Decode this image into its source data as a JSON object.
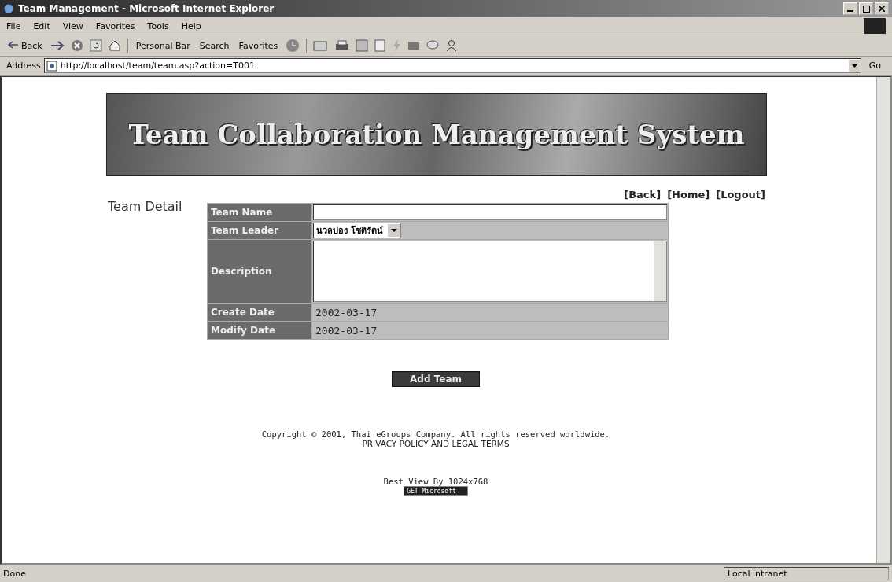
{
  "window": {
    "title": "Team Management - Microsoft Internet Explorer"
  },
  "menu": [
    "File",
    "Edit",
    "View",
    "Favorites",
    "Tools",
    "Help"
  ],
  "toolbar": {
    "back": "Back",
    "personal_bar": "Personal Bar",
    "search": "Search",
    "favorites": "Favorites"
  },
  "address": {
    "label": "Address",
    "url": "http://localhost/team/team.asp?action=T001",
    "go": "Go"
  },
  "page": {
    "banner": "Team Collaboration Management System",
    "heading": "Team Detail",
    "links": [
      "[Back]",
      "[Home]",
      "[Logout]"
    ],
    "form": [
      {
        "kind": "text",
        "label": "Team Name"
      },
      {
        "kind": "select",
        "label": "Team Leader",
        "value": "นวลปอง โชติรัตน์"
      },
      {
        "kind": "textarea",
        "label": "Description"
      },
      {
        "kind": "static",
        "label": "Create Date",
        "value": "2002-03-17"
      },
      {
        "kind": "static",
        "label": "Modify Date",
        "value": "2002-03-17"
      }
    ],
    "submit": "Add Team",
    "copyright": "Copyright © 2001, Thai eGroups Company. All rights reserved worldwide.",
    "privacy": "PRIVACY POLICY AND LEGAL TERMS",
    "best_view": "Best View By 1024x768",
    "badge": "GET Microsoft"
  },
  "status_bar": {
    "text": "Done",
    "zone": "Local intranet"
  }
}
